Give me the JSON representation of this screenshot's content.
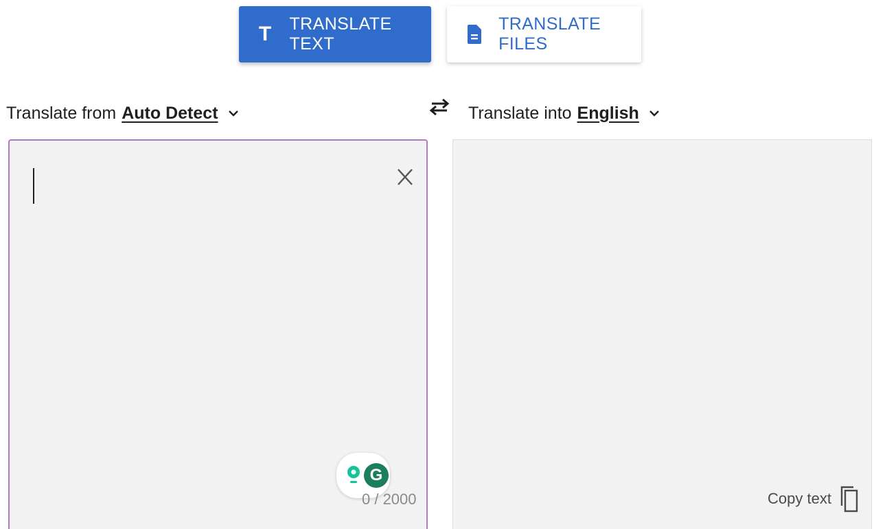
{
  "tabs": {
    "text": {
      "label": "TRANSLATE TEXT",
      "icon": "text-format-icon"
    },
    "files": {
      "label": "TRANSLATE FILES",
      "icon": "file-document-icon"
    }
  },
  "source": {
    "prefix": "Translate from",
    "language": "Auto Detect",
    "value": "",
    "char_count": "0 / 2000"
  },
  "target": {
    "prefix": "Translate into",
    "language": "English",
    "copy_label": "Copy text"
  },
  "colors": {
    "primary": "#2f6ccb",
    "focus_border": "#b27ac2",
    "panel_bg": "#f2f2f2",
    "grammarly": "#1b7f5e"
  }
}
